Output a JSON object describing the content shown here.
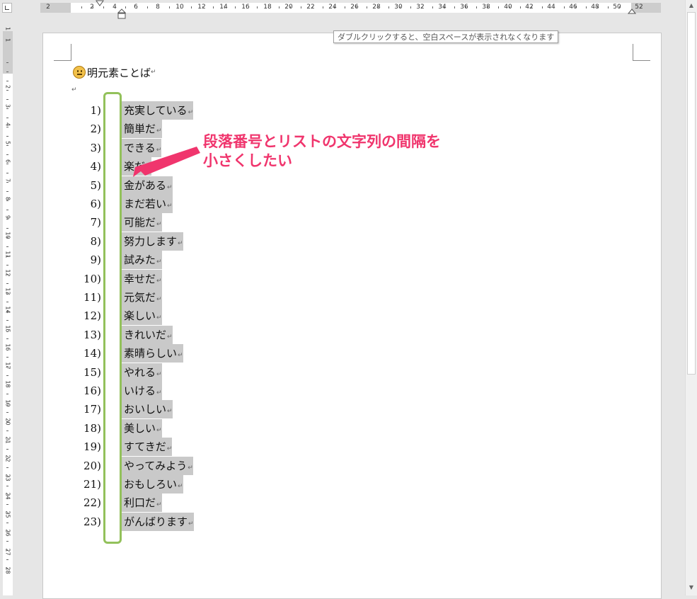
{
  "ruler": {
    "horizontal_numbers": [
      "2",
      "2",
      "4",
      "6",
      "8",
      "10",
      "12",
      "14",
      "16",
      "18",
      "20",
      "22",
      "24",
      "26",
      "28",
      "30",
      "32",
      "34",
      "36",
      "38",
      "40",
      "42",
      "44",
      "46",
      "48",
      "50",
      "52"
    ],
    "vertical_numbers": [
      "1",
      "1",
      "2",
      "3",
      "4",
      "5",
      "6",
      "7",
      "8",
      "9",
      "10",
      "11",
      "12",
      "13",
      "14",
      "15",
      "16",
      "17",
      "18",
      "19",
      "20",
      "21",
      "22",
      "23",
      "24",
      "25",
      "26",
      "27",
      "28"
    ]
  },
  "tooltip": {
    "text": "ダブルクリックすると、空白スペースが表示されなくなります"
  },
  "document": {
    "heading": "明元素ことば",
    "paragraph_mark": "↵",
    "list_items": [
      {
        "num": "1)",
        "text": "充実している"
      },
      {
        "num": "2)",
        "text": "簡単だ"
      },
      {
        "num": "3)",
        "text": "できる"
      },
      {
        "num": "4)",
        "text": "楽だ"
      },
      {
        "num": "5)",
        "text": "金がある"
      },
      {
        "num": "6)",
        "text": "まだ若い"
      },
      {
        "num": "7)",
        "text": "可能だ"
      },
      {
        "num": "8)",
        "text": "努力します"
      },
      {
        "num": "9)",
        "text": "試みた"
      },
      {
        "num": "10)",
        "text": "幸せだ"
      },
      {
        "num": "11)",
        "text": "元気だ"
      },
      {
        "num": "12)",
        "text": "楽しい"
      },
      {
        "num": "13)",
        "text": "きれいだ"
      },
      {
        "num": "14)",
        "text": "素晴らしい"
      },
      {
        "num": "15)",
        "text": "やれる"
      },
      {
        "num": "16)",
        "text": "いける"
      },
      {
        "num": "17)",
        "text": "おいしい"
      },
      {
        "num": "18)",
        "text": "美しい"
      },
      {
        "num": "19)",
        "text": "すてきだ"
      },
      {
        "num": "20)",
        "text": "やってみよう"
      },
      {
        "num": "21)",
        "text": "おもしろい"
      },
      {
        "num": "22)",
        "text": "利口だ"
      },
      {
        "num": "23)",
        "text": "がんばります"
      }
    ]
  },
  "annotation": {
    "line1": "段落番号とリストの文字列の間隔を",
    "line2": "小さくしたい",
    "color": "#f0356d"
  },
  "colors": {
    "highlight_border": "#93c15b",
    "selection": "#c9c9c9"
  }
}
